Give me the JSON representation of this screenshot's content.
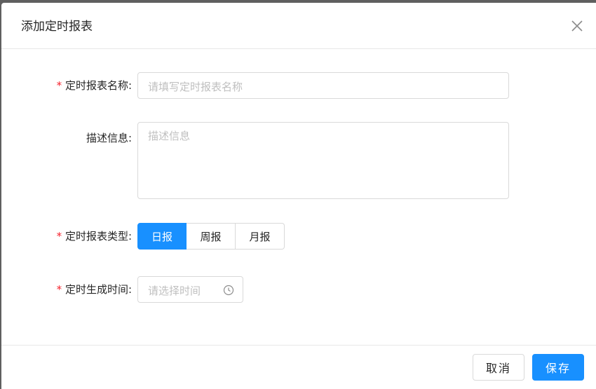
{
  "dialog": {
    "title": "添加定时报表"
  },
  "form": {
    "name": {
      "label": "定时报表名称:",
      "placeholder": "请填写定时报表名称",
      "required": true
    },
    "description": {
      "label": "描述信息:",
      "placeholder": "描述信息",
      "required": false
    },
    "type": {
      "label": "定时报表类型:",
      "required": true,
      "options": [
        "日报",
        "周报",
        "月报"
      ],
      "selected": "日报"
    },
    "time": {
      "label": "定时生成时间:",
      "placeholder": "请选择时间",
      "required": true
    }
  },
  "footer": {
    "cancel_label": "取消",
    "save_label": "保存"
  },
  "colors": {
    "accent": "#1890ff",
    "required": "#f5222d",
    "placeholder": "#bfbfbf",
    "border": "#d9d9d9"
  },
  "icons": {
    "close": "close-icon",
    "time": "clock-icon"
  }
}
